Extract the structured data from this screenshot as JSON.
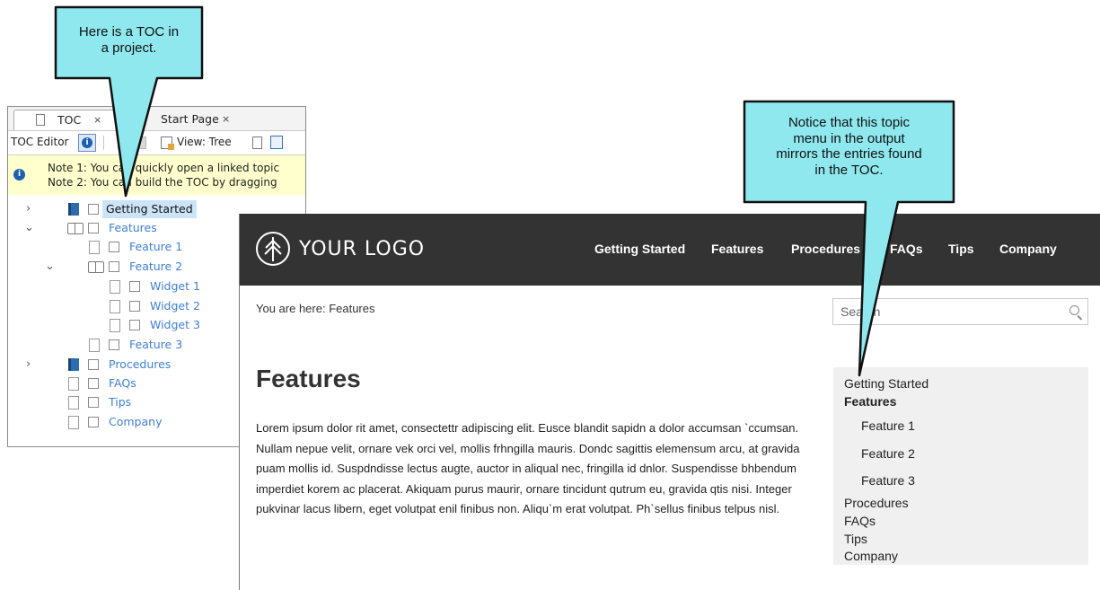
{
  "toc_panel": {
    "tabs": [
      {
        "label": "TOC",
        "close": "×"
      },
      {
        "label": "Start Page",
        "close": "×"
      }
    ],
    "toolbar": {
      "editor_label": "TOC Editor",
      "view_label": "View: Tree"
    },
    "notes": [
      "Note 1: You can quickly open a linked topic",
      "Note 2: You can build the TOC by dragging"
    ],
    "tree": [
      {
        "label": "Getting Started"
      },
      {
        "label": "Features"
      },
      {
        "label": "Feature 1"
      },
      {
        "label": "Feature 2"
      },
      {
        "label": "Widget 1"
      },
      {
        "label": "Widget 2"
      },
      {
        "label": "Widget 3"
      },
      {
        "label": "Feature 3"
      },
      {
        "label": "Procedures"
      },
      {
        "label": "FAQs"
      },
      {
        "label": "Tips"
      },
      {
        "label": "Company"
      }
    ]
  },
  "site": {
    "logo_text": "YOUR LOGO",
    "nav": [
      "Getting Started",
      "Features",
      "Procedures",
      "FAQs",
      "Tips",
      "Company"
    ],
    "breadcrumb": "You are here: Features",
    "search_placeholder": "Search",
    "page_title": "Features",
    "body_text": "Lorem ipsum dolor rit amet, consectettr adipiscing elit. Eusce blandit sapidn a dolor accumsan `ccumsan. Nullam nepue velit, ornare vek orci vel, mollis frhngilla mauris. Dondc sagittis elemensum arcu, at gravida puam mollis id. Suspdndisse lectus augte, auctor in aliqual nec, fringilla id dnlor. Suspendisse bhbendum imperdiet korem ac placerat. Akiquam purus maurir, ornare tincidunt qutrum eu, gravida qtis nisi. Integer pukvinar lacus libern, eget volutpat enil finibus non. Aliqu`m erat volutpat. Ph`sellus finibus telpus nisl.",
    "side_menu": [
      {
        "label": "Getting Started"
      },
      {
        "label": "Features"
      },
      {
        "label": "Feature 1"
      },
      {
        "label": "Feature 2"
      },
      {
        "label": "Feature 3"
      },
      {
        "label": "Procedures"
      },
      {
        "label": "FAQs"
      },
      {
        "label": "Tips"
      },
      {
        "label": "Company"
      }
    ]
  },
  "callouts": {
    "left": [
      "Here is a TOC in",
      "a project."
    ],
    "right": [
      "Notice that this topic",
      "menu in the output",
      "mirrors the entries found",
      "in the TOC."
    ]
  },
  "colors": {
    "callout_fill": "#8ee8ee",
    "header_bg": "#333333",
    "link_blue": "#3e7fd6",
    "note_bg": "#ffffcd",
    "menu_bg": "#f0f0f0"
  },
  "icons": [
    "document-icon",
    "info-icon",
    "view-tree-icon",
    "book-closed-icon",
    "book-open-icon",
    "page-icon",
    "checkbox-icon",
    "chevron-right-icon",
    "chevron-down-icon",
    "search-icon",
    "logo-tree-icon"
  ]
}
